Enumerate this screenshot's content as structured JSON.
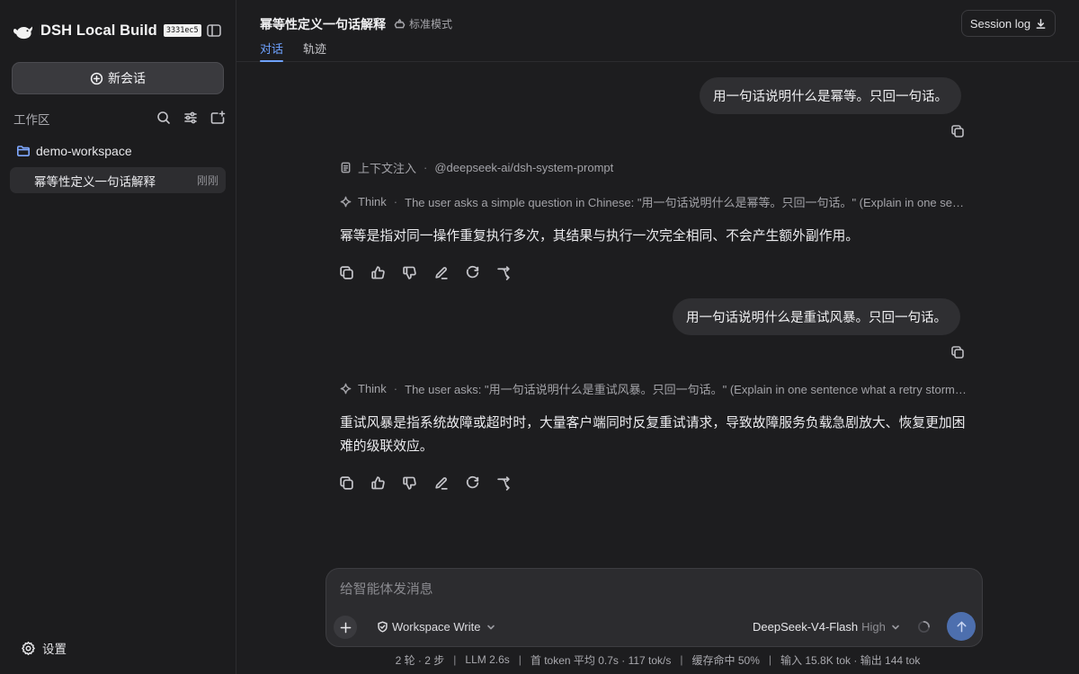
{
  "app": {
    "name": "DSH Local Build",
    "build": "3331ec5"
  },
  "sidebar": {
    "new_chat_label": "新会话",
    "workspace_section_title": "工作区",
    "workspace": {
      "name": "demo-workspace"
    },
    "sessions": [
      {
        "title": "幂等性定义一句话解释",
        "time": "刚刚"
      }
    ],
    "settings_label": "设置"
  },
  "header": {
    "title": "幂等性定义一句话解释",
    "mode": "标准模式",
    "tabs": [
      {
        "label": "对话",
        "active": true
      },
      {
        "label": "轨迹",
        "active": false
      }
    ],
    "session_log_label": "Session log"
  },
  "conversation": {
    "messages": [
      {
        "role": "user",
        "text": "用一句话说明什么是幂等。只回一句话。"
      },
      {
        "role": "assistant",
        "context_label": "上下文注入",
        "context_source": "@deepseek-ai/dsh-system-prompt",
        "think_label": "Think",
        "think_text": "The user asks a simple question in Chinese: \"用一句话说明什么是幂等。只回一句话。\" (Explain in one sentence what idempotency is. Only reply one sentence.)",
        "text": "幂等是指对同一操作重复执行多次，其结果与执行一次完全相同、不会产生额外副作用。"
      },
      {
        "role": "user",
        "text": "用一句话说明什么是重试风暴。只回一句话。"
      },
      {
        "role": "assistant",
        "think_label": "Think",
        "think_text": "The user asks: \"用一句话说明什么是重试风暴。只回一句话。\" (Explain in one sentence what a retry storm is. Only reply one sentence.)",
        "text": "重试风暴是指系统故障或超时时，大量客户端同时反复重试请求，导致故障服务负载急剧放大、恢复更加困难的级联效应。"
      }
    ]
  },
  "composer": {
    "placeholder": "给智能体发消息",
    "permission": "Workspace Write",
    "model": "DeepSeek-V4-Flash",
    "effort": "High"
  },
  "stats": {
    "turns": "2 轮 · 2 步",
    "llm": "LLM 2.6s",
    "first_token": "首 token 平均 0.7s · 117 tok/s",
    "cache": "缓存命中 50%",
    "tokens": "输入 15.8K tok · 输出 144 tok"
  },
  "icons": {
    "logo": "whale-logo-icon",
    "sidebar_toggle": "sidebar-toggle-icon",
    "new_chat": "plus-circle-icon",
    "search": "search-icon",
    "filter": "sliders-icon",
    "new_folder": "folder-plus-icon",
    "folder": "folder-icon",
    "settings": "gear-icon",
    "mode": "recycle-icon",
    "download": "download-icon",
    "copy": "copy-icon",
    "document": "document-icon",
    "think": "sparkle-icon",
    "thumbs_up": "thumbs-up-icon",
    "thumbs_down": "thumbs-down-icon",
    "edit": "pencil-icon",
    "regenerate": "refresh-icon",
    "branch": "branch-icon",
    "add": "plus-icon",
    "shield": "shield-icon",
    "chevron": "chevron-down-icon",
    "send": "arrow-up-icon",
    "spinner": "spinner-icon"
  },
  "colors": {
    "accent": "#6ea2ff",
    "background": "#1d1d1f",
    "sidebar": "#1c1c1e",
    "bubble": "#2f2f32",
    "send": "#4d6fae"
  }
}
